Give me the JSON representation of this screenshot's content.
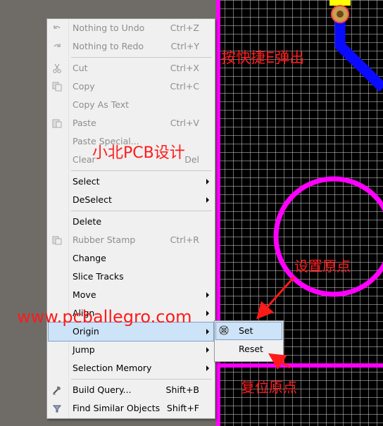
{
  "menu": {
    "items": [
      {
        "label": "Nothing to Undo",
        "shortcut": "Ctrl+Z",
        "disabled": true,
        "icon": "undo-icon"
      },
      {
        "label": "Nothing to Redo",
        "shortcut": "Ctrl+Y",
        "disabled": true,
        "icon": "redo-icon"
      },
      {
        "label": "Cut",
        "shortcut": "Ctrl+X",
        "disabled": true,
        "icon": "scissors-icon"
      },
      {
        "label": "Copy",
        "shortcut": "Ctrl+C",
        "disabled": true,
        "icon": "copy-icon"
      },
      {
        "label": "Copy As Text",
        "shortcut": "",
        "disabled": true
      },
      {
        "label": "Paste",
        "shortcut": "Ctrl+V",
        "disabled": true,
        "icon": "paste-icon"
      },
      {
        "label": "Paste Special...",
        "shortcut": "",
        "disabled": true
      },
      {
        "label": "Clear",
        "shortcut": "Del",
        "disabled": true
      },
      {
        "label": "Select",
        "submenu": true
      },
      {
        "label": "DeSelect",
        "submenu": true
      },
      {
        "label": "Delete"
      },
      {
        "label": "Rubber Stamp",
        "shortcut": "Ctrl+R",
        "disabled": true,
        "icon": "stamp-icon"
      },
      {
        "label": "Change"
      },
      {
        "label": "Slice Tracks"
      },
      {
        "label": "Move",
        "submenu": true
      },
      {
        "label": "Align",
        "submenu": true
      },
      {
        "label": "Origin",
        "submenu": true,
        "highlighted": true
      },
      {
        "label": "Jump",
        "submenu": true
      },
      {
        "label": "Selection Memory",
        "submenu": true
      },
      {
        "label": "Build Query...",
        "shortcut": "Shift+B",
        "icon": "build-query-icon"
      },
      {
        "label": "Find Similar Objects",
        "shortcut": "Shift+F",
        "icon": "funnel-icon"
      }
    ]
  },
  "submenu": {
    "items": [
      {
        "label": "Set",
        "highlighted": true,
        "icon": "origin-target-icon"
      },
      {
        "label": "Reset"
      }
    ]
  },
  "annotations": {
    "press_e": "按快捷E弹出",
    "brand": "小北PCB设计",
    "set_origin": "设置原点",
    "website": "www.pcballegro.com",
    "reset_origin": "复位原点"
  },
  "colors": {
    "board_outline": "#ff00ff",
    "track": "#0a0aff",
    "pad": "#b8860b",
    "annotation": "#ff1a1a",
    "highlight": "#cde3f7"
  }
}
